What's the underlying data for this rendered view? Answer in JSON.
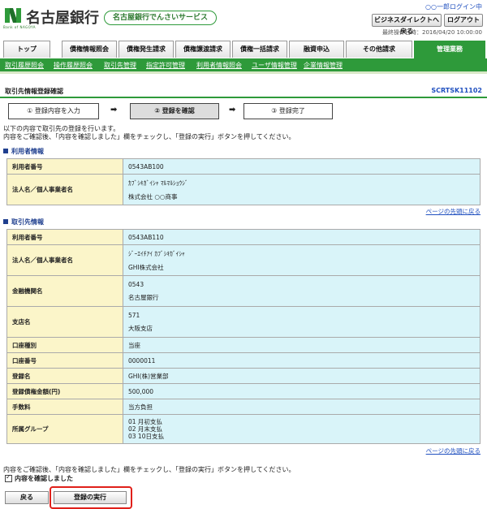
{
  "header": {
    "bank_name": "名古屋銀行",
    "logo_sub": "Bank of NAGOYA",
    "service_name": "名古屋銀行でんさいサービス",
    "user_status": "○○一郎ログイン中",
    "btn_return_bizdirect": "ビジネスダイレクトへ戻る",
    "btn_logout": "ログアウト",
    "last_operation": "最終操作日時：2016/04/20 10:00:00"
  },
  "tabs": [
    "トップ",
    "債権情報照会",
    "債権発生請求",
    "債権譲渡請求",
    "債権一括請求",
    "融資申込",
    "その他請求",
    "管理業務"
  ],
  "subnav": [
    "取引履歴照会",
    "操作履歴照会",
    "取引先管理",
    "指定許可管理",
    "利用者情報照会",
    "ユーザ情報管理",
    "企業情報管理"
  ],
  "page": {
    "title": "取引先情報登録確認",
    "screen_id": "SCRTSK11102"
  },
  "steps": [
    "① 登録内容を入力",
    "② 登録を確認",
    "③ 登録完了"
  ],
  "arrow": "➡",
  "instructions": {
    "line1": "以下の内容で取引先の登録を行います。",
    "line2": "内容をご確認後、「内容を確認しました」欄をチェックし、「登録の実行」ボタンを押してください。"
  },
  "user_section": {
    "heading": "利用者情報",
    "rows": [
      {
        "label": "利用者番号",
        "values": [
          "0543AB100"
        ]
      },
      {
        "label": "法人名／個人事業者名",
        "values": [
          "ｶﾌﾞｼｷｶﾞｲｼｬ ﾏﾙﾏﾙｼｮｳｼﾞ",
          "株式会社 ○○商事"
        ]
      }
    ]
  },
  "partner_section": {
    "heading": "取引先情報",
    "rows": [
      {
        "label": "利用者番号",
        "values": [
          "0543AB110"
        ]
      },
      {
        "label": "法人名／個人事業者名",
        "values": [
          "ｼﾞｰｴｲﾁｱｲ ｶﾌﾞｼｷｶﾞｲｼｬ",
          "GHI株式会社"
        ]
      },
      {
        "label": "金融機関名",
        "values": [
          "0543",
          "名古屋銀行"
        ]
      },
      {
        "label": "支店名",
        "values": [
          "571",
          "大阪支店"
        ]
      },
      {
        "label": "口座種別",
        "values": [
          "当座"
        ]
      },
      {
        "label": "口座番号",
        "values": [
          "0000011"
        ]
      },
      {
        "label": "登録名",
        "values": [
          "GHI(株)営業部"
        ]
      },
      {
        "label": "登録債権金額(円)",
        "values": [
          "500,000"
        ]
      },
      {
        "label": "手数料",
        "values": [
          "当方負担"
        ]
      },
      {
        "label": "所属グループ",
        "values": [
          "01 月初支払",
          "02 月末支払",
          "03 10日支払"
        ]
      }
    ]
  },
  "to_top_link": "ページの先頭に戻る",
  "bottom": {
    "instruction": "内容をご確認後、「内容を確認しました」欄をチェックし、「登録の実行」ボタンを押してください。",
    "checkbox_label": "内容を確認しました",
    "btn_back": "戻る",
    "btn_execute": "登録の実行"
  },
  "colors": {
    "accent_green": "#2e9a3a",
    "label_bg": "#fbf5c9",
    "value_bg": "#d9f4f9",
    "highlight_red": "#e0201a"
  }
}
